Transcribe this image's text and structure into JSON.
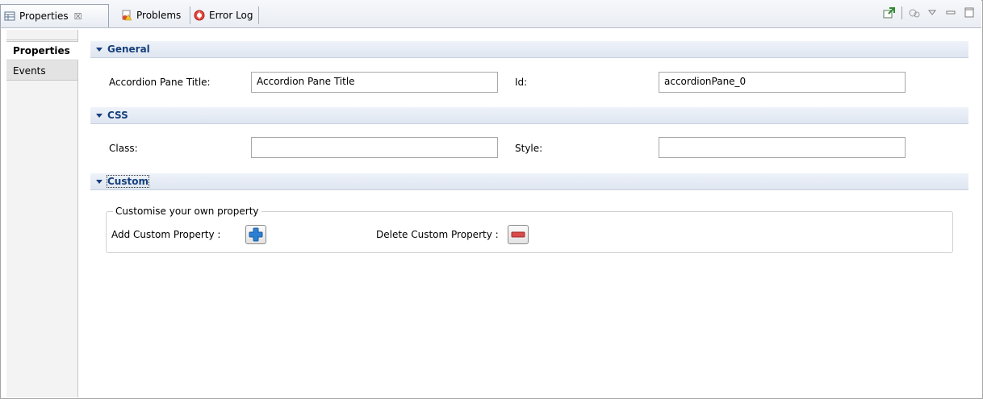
{
  "tabs": [
    {
      "label": "Properties",
      "icon": "properties-icon",
      "close": "☒"
    },
    {
      "label": "Problems",
      "icon": "problems-icon"
    },
    {
      "label": "Error Log",
      "icon": "error-log-icon"
    }
  ],
  "toolbar_icons": [
    "pin-icon",
    "filter-icon",
    "view-menu-icon",
    "minimize-icon",
    "maximize-icon"
  ],
  "left_tabs": {
    "properties": "Properties",
    "events": "Events"
  },
  "sections": {
    "general": "General",
    "css": "CSS",
    "custom": "Custom"
  },
  "general": {
    "title_label": "Accordion Pane Title:",
    "title_value": "Accordion Pane Title",
    "id_label": "Id:",
    "id_value": "accordionPane_0"
  },
  "css": {
    "class_label": "Class:",
    "class_value": "",
    "style_label": "Style:",
    "style_value": ""
  },
  "custom": {
    "group_label": "Customise your own property",
    "add_label": "Add Custom Property :",
    "delete_label": "Delete Custom Property :"
  },
  "colors": {
    "section_title": "#16407c",
    "add_button": "#2d7fd4",
    "delete_button": "#d84b4b"
  }
}
